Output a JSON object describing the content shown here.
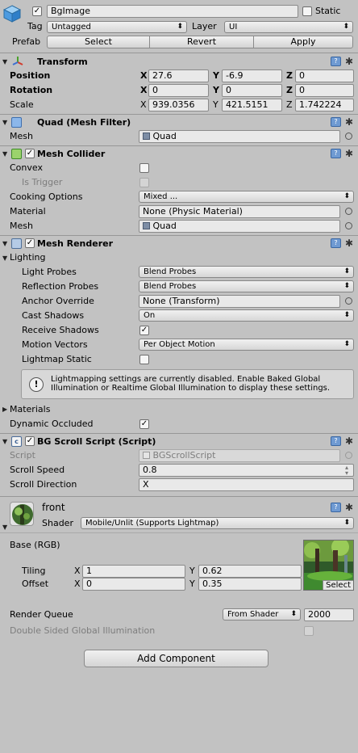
{
  "object": {
    "name": "BgImage",
    "static_label": "Static",
    "tag_label": "Tag",
    "tag_value": "Untagged",
    "layer_label": "Layer",
    "layer_value": "UI",
    "prefab_label": "Prefab",
    "prefab_buttons": [
      "Select",
      "Revert",
      "Apply"
    ]
  },
  "transform": {
    "title": "Transform",
    "rows": [
      {
        "label": "Position",
        "x": "27.6",
        "y": "-6.9",
        "z": "0"
      },
      {
        "label": "Rotation",
        "x": "0",
        "y": "0",
        "z": "0"
      },
      {
        "label": "Scale",
        "x": "939.0356",
        "y": "421.5151",
        "z": "1.742224"
      }
    ],
    "axes": [
      "X",
      "Y",
      "Z"
    ]
  },
  "mesh_filter": {
    "title": "Quad (Mesh Filter)",
    "mesh_label": "Mesh",
    "mesh_value": "Quad"
  },
  "mesh_collider": {
    "title": "Mesh Collider",
    "convex_label": "Convex",
    "is_trigger_label": "Is Trigger",
    "cooking_label": "Cooking Options",
    "cooking_value": "Mixed ...",
    "material_label": "Material",
    "material_value": "None (Physic Material)",
    "mesh_label": "Mesh",
    "mesh_value": "Quad"
  },
  "mesh_renderer": {
    "title": "Mesh Renderer",
    "lighting_label": "Lighting",
    "light_probes_label": "Light Probes",
    "light_probes_value": "Blend Probes",
    "reflection_probes_label": "Reflection Probes",
    "reflection_probes_value": "Blend Probes",
    "anchor_override_label": "Anchor Override",
    "anchor_override_value": "None (Transform)",
    "cast_shadows_label": "Cast Shadows",
    "cast_shadows_value": "On",
    "receive_shadows_label": "Receive Shadows",
    "motion_vectors_label": "Motion Vectors",
    "motion_vectors_value": "Per Object Motion",
    "lightmap_static_label": "Lightmap Static",
    "info_text": "Lightmapping settings are currently disabled. Enable Baked Global Illumination or Realtime Global Illumination to display these settings.",
    "materials_label": "Materials",
    "dynamic_occluded_label": "Dynamic Occluded"
  },
  "bg_scroll": {
    "title": "BG Scroll Script (Script)",
    "script_label": "Script",
    "script_value": "BGScrollScript",
    "scroll_speed_label": "Scroll Speed",
    "scroll_speed_value": "0.8",
    "scroll_direction_label": "Scroll Direction",
    "scroll_direction_value": "X"
  },
  "material": {
    "name": "front",
    "shader_label": "Shader",
    "shader_value": "Mobile/Unlit (Supports Lightmap)",
    "base_label": "Base (RGB)",
    "tiling_label": "Tiling",
    "tiling_x": "1",
    "tiling_y": "0.62",
    "offset_label": "Offset",
    "offset_x": "0",
    "offset_y": "0.35",
    "select_label": "Select",
    "render_queue_label": "Render Queue",
    "render_queue_mode": "From Shader",
    "render_queue_value": "2000",
    "double_sided_label": "Double Sided Global Illumination"
  },
  "add_component_label": "Add Component",
  "colors": {
    "panel": "#c2c2c2",
    "header_separator": "#979797",
    "help_icon": "#6f9ad2"
  }
}
